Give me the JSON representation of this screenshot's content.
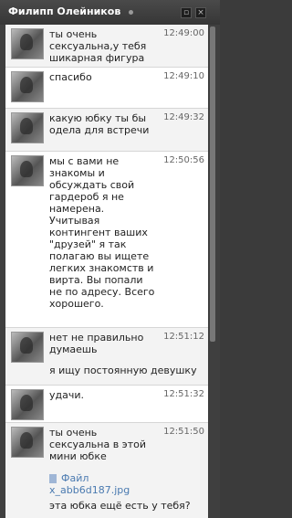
{
  "chat": {
    "title": "Филипп Олейников",
    "min_glyph": "▫",
    "close_glyph": "×"
  },
  "messages": [
    {
      "text": "ты очень сексуальна,у тебя шикарная фигура",
      "time": "12:49:00"
    },
    {
      "text": "спасибо",
      "time": "12:49:10"
    },
    {
      "text": "какую юбку ты бы одела для встречи",
      "time": "12:49:32"
    },
    {
      "text": "мы с вами не знакомы и обсуждать свой гардероб я не намерена. Учитывая контингент ваших \"друзей\" я так полагаю вы ищете легких знакомств и вирта. Вы попали не по адресу. Всего хорошего.",
      "time": "12:50:56"
    },
    {
      "text": "нет не правильно думаешь",
      "time": "12:51:12",
      "extra": "я ищу постоянную девушку"
    },
    {
      "text": "удачи.",
      "time": "12:51:32"
    },
    {
      "text": "ты очень сексуальна в этой мини юбке",
      "time": "12:51:50",
      "file_label": "Файл",
      "file_name": "x_abb6d187.jpg",
      "extra": "эта юбка ещё есть у тебя?"
    }
  ]
}
